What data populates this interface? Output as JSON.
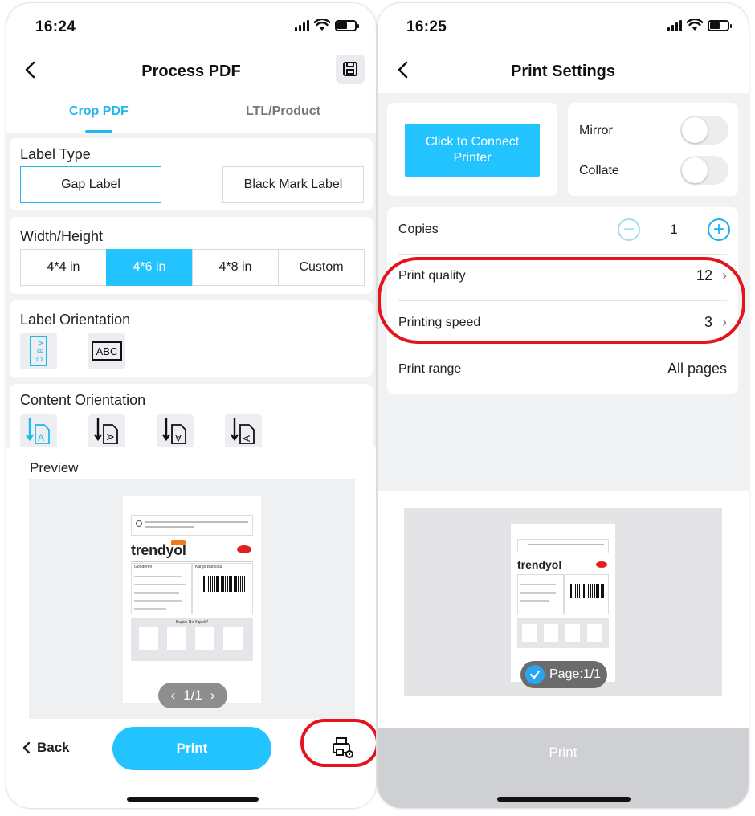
{
  "left": {
    "status_time": "16:24",
    "nav_title": "Process PDF",
    "tabs": [
      {
        "label": "Crop PDF"
      },
      {
        "label": "LTL/Product"
      }
    ],
    "label_type": {
      "title": "Label Type",
      "options": [
        {
          "label": "Gap Label",
          "selected": true
        },
        {
          "label": "Black Mark Label",
          "selected": false
        }
      ]
    },
    "width_height": {
      "title": "Width/Height",
      "options": [
        {
          "label": "4*4 in",
          "selected": false
        },
        {
          "label": "4*6 in",
          "selected": true
        },
        {
          "label": "4*8 in",
          "selected": false
        },
        {
          "label": "Custom",
          "selected": false
        }
      ]
    },
    "label_orientation": {
      "title": "Label Orientation",
      "options": [
        {
          "label": "ABC"
        },
        {
          "label": "ABC"
        }
      ]
    },
    "content_orientation": {
      "title": "Content Orientation"
    },
    "preview": {
      "title": "Preview",
      "pager": "1/1",
      "sheet": {
        "brand": "trendyol",
        "sender_heading": "Gönderen",
        "barcode_heading": "Kargo Barkodu",
        "survey_title": "Bugün Ne Yaptık?"
      }
    },
    "bottom": {
      "back_label": "Back",
      "print_label": "Print"
    }
  },
  "right": {
    "status_time": "16:25",
    "nav_title": "Print Settings",
    "connect_label": "Click to Connect Printer",
    "mirror_label": "Mirror",
    "collate_label": "Collate",
    "copies": {
      "label": "Copies",
      "value": "1"
    },
    "print_quality": {
      "label": "Print quality",
      "value": "12"
    },
    "printing_speed": {
      "label": "Printing speed",
      "value": "3"
    },
    "print_range": {
      "label": "Print range",
      "value": "All pages"
    },
    "page_badge": "Page:1/1",
    "print_label": "Print"
  },
  "colors": {
    "accent": "#23c3ff",
    "highlight_red": "#e3141b",
    "page_bg": "#f1f2f4"
  }
}
